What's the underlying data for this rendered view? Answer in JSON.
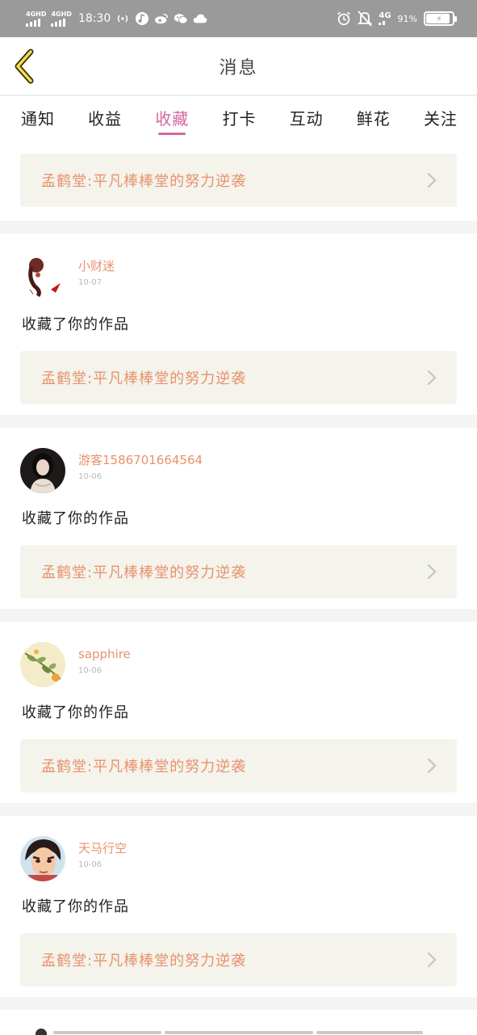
{
  "status_bar": {
    "net1": "4GHD",
    "net2": "4GHD",
    "time": "18:30",
    "net3": "4G",
    "battery": "91%",
    "battery_level": 0.91,
    "icons": [
      "broadcast-icon",
      "music-icon",
      "weibo-icon",
      "wechat-icon",
      "cloud-icon",
      "alarm-icon",
      "mute-bell-icon",
      "battery-icon"
    ]
  },
  "header": {
    "title": "消息",
    "back_icon": "back-chevron-icon"
  },
  "tabs": [
    {
      "label": "通知",
      "active": false
    },
    {
      "label": "收益",
      "active": false
    },
    {
      "label": "收藏",
      "active": true
    },
    {
      "label": "打卡",
      "active": false
    },
    {
      "label": "互动",
      "active": false
    },
    {
      "label": "鲜花",
      "active": false
    },
    {
      "label": "关注",
      "active": false
    }
  ],
  "top_card": {
    "title": "孟鹤堂:平凡棒棒堂的努力逆袭"
  },
  "items": [
    {
      "username": "小财迷",
      "date": "10-07",
      "action": "收藏了你的作品",
      "work_title": "孟鹤堂:平凡棒棒堂的努力逆袭"
    },
    {
      "username": "游客1586701664564",
      "date": "10-06",
      "action": "收藏了你的作品",
      "work_title": "孟鹤堂:平凡棒棒堂的努力逆袭"
    },
    {
      "username": "sapphire",
      "date": "10-06",
      "action": "收藏了你的作品",
      "work_title": "孟鹤堂:平凡棒棒堂的努力逆袭"
    },
    {
      "username": "天马行空",
      "date": "10-06",
      "action": "收藏了你的作品",
      "work_title": "孟鹤堂:平凡棒棒堂的努力逆袭"
    }
  ],
  "colors": {
    "accent": "#d467a1",
    "work_title": "#e8926c",
    "card_bg": "#f4f3ec",
    "status_bar": "#9a9a9a"
  }
}
